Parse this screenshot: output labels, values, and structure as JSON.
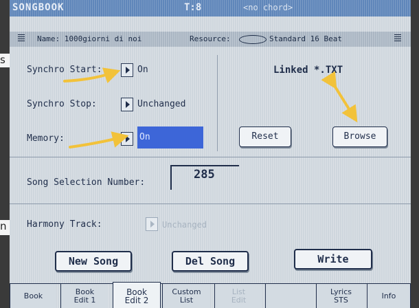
{
  "edge_text": {
    "top": "s",
    "bottom": "n"
  },
  "title_bar": {
    "app": "SONGBOOK",
    "tempo": "T:8",
    "chord": "<no chord>"
  },
  "info_bar": {
    "name": "Name: 1000giorni di noi",
    "resource_label": "Resource:",
    "style": "Standard 16 Beat"
  },
  "synchro_start": {
    "label": "Synchro Start:",
    "value": "On"
  },
  "synchro_stop": {
    "label": "Synchro Stop:",
    "value": "Unchanged"
  },
  "memory": {
    "label": "Memory:",
    "value": "On"
  },
  "linked_text": "Linked *.TXT",
  "reset_label": "Reset",
  "browse_label": "Browse",
  "song_selection": {
    "label": "Song Selection Number:",
    "value": "285"
  },
  "harmony_track": {
    "label": "Harmony Track:",
    "value": "Unchanged"
  },
  "actions": {
    "new_song": "New Song",
    "del_song": "Del Song",
    "write": "Write"
  },
  "tabs": [
    {
      "l1": "Book",
      "l2": ""
    },
    {
      "l1": "Book",
      "l2": "Edit 1"
    },
    {
      "l1": "Book",
      "l2": "Edit 2"
    },
    {
      "l1": "Custom",
      "l2": "List"
    },
    {
      "l1": "List",
      "l2": "Edit"
    },
    {
      "l1": "Lyrics",
      "l2": "STS"
    },
    {
      "l1": "Info",
      "l2": ""
    }
  ],
  "colors": {
    "title_bar": "#5f86ba",
    "screen": "#ced6dd",
    "highlight": "#3d66d8",
    "annotation_arrow": "#f2c23a"
  }
}
